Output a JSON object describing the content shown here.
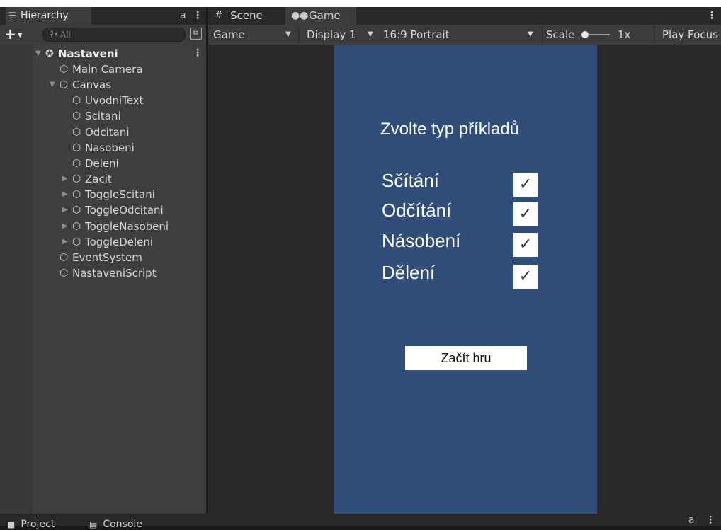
{
  "hierarchy": {
    "tab_label": "Hierarchy",
    "tab_icon": "list-icon",
    "search_placeholder": "All",
    "scene_name": "Nastaveni",
    "items": [
      {
        "label": "Main Camera",
        "depth": 1,
        "expander": "none"
      },
      {
        "label": "Canvas",
        "depth": 1,
        "expander": "expanded"
      },
      {
        "label": "UvodniText",
        "depth": 2,
        "expander": "none"
      },
      {
        "label": "Scitani",
        "depth": 2,
        "expander": "none"
      },
      {
        "label": "Odcitani",
        "depth": 2,
        "expander": "none"
      },
      {
        "label": "Nasobeni",
        "depth": 2,
        "expander": "none"
      },
      {
        "label": "Deleni",
        "depth": 2,
        "expander": "none"
      },
      {
        "label": "Zacit",
        "depth": 2,
        "expander": "collapsed"
      },
      {
        "label": "ToggleScitani",
        "depth": 2,
        "expander": "collapsed"
      },
      {
        "label": "ToggleOdcitani",
        "depth": 2,
        "expander": "collapsed"
      },
      {
        "label": "ToggleNasobeni",
        "depth": 2,
        "expander": "collapsed"
      },
      {
        "label": "ToggleDeleni",
        "depth": 2,
        "expander": "collapsed"
      },
      {
        "label": "EventSystem",
        "depth": 1,
        "expander": "none"
      },
      {
        "label": "NastaveniScript",
        "depth": 1,
        "expander": "none"
      }
    ]
  },
  "editor_tabs": {
    "scene": "Scene",
    "game": "Game",
    "active": "Game"
  },
  "game_toolbar": {
    "mode": "Game",
    "display": "Display 1",
    "aspect": "16:9 Portrait",
    "scale_label": "Scale",
    "scale_value": "1x",
    "play_focus": "Play Focus"
  },
  "game_view": {
    "background": "#304e79",
    "title": "Zvolte typ příkladů",
    "options": [
      {
        "label": "Sčítání",
        "checked": true
      },
      {
        "label": "Odčítání",
        "checked": true
      },
      {
        "label": "Násobení",
        "checked": true
      },
      {
        "label": "Dělení",
        "checked": true
      }
    ],
    "start_button": "Začít hru"
  },
  "bottom_tabs": {
    "project": "Project",
    "console": "Console"
  }
}
